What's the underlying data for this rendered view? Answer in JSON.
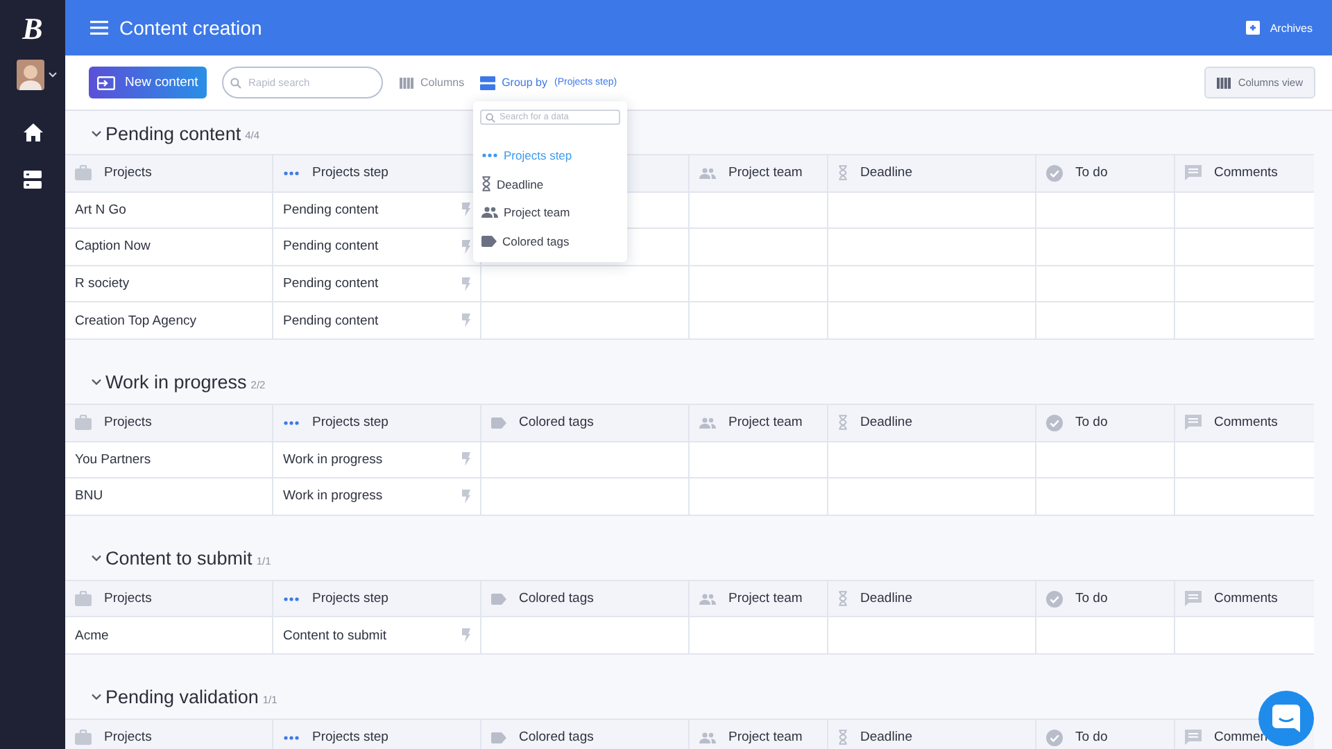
{
  "sidebar": {
    "logo": "B"
  },
  "header": {
    "title": "Content creation",
    "archives": "Archives"
  },
  "toolbar": {
    "new_button": "New content",
    "search": {
      "placeholder": "Rapid search"
    },
    "columns_button": "Columns",
    "group_by": {
      "label": "Group by",
      "value": "(Projects step)"
    },
    "view_button": "Columns view"
  },
  "group_menu": {
    "search": {
      "placeholder": "Search for a data"
    },
    "items": [
      {
        "label": "Projects step",
        "selected": true
      },
      {
        "label": "Deadline",
        "selected": false
      },
      {
        "label": "Project team",
        "selected": false
      },
      {
        "label": "Colored tags",
        "selected": false
      }
    ]
  },
  "sections": [
    {
      "title": "Pending content",
      "count": "4/4",
      "expanded": true,
      "columns": [
        {
          "label": "Projects"
        },
        {
          "label": "Projects step"
        },
        {},
        {
          "label": "Project team"
        },
        {
          "label": "Deadline"
        },
        {
          "label": "To do"
        },
        {
          "label": "Comments"
        }
      ],
      "rows": [
        {
          "project": "Art N Go",
          "step": "Pending content"
        },
        {
          "project": "Caption Now",
          "step": "Pending content"
        },
        {
          "project": "R society",
          "step": "Pending content"
        },
        {
          "project": "Creation Top Agency",
          "step": "Pending content"
        }
      ]
    },
    {
      "title": "Work in progress",
      "count": "2/2",
      "expanded": true,
      "columns": [
        {
          "label": "Projects"
        },
        {
          "label": "Projects step"
        },
        {
          "label": "Colored tags"
        },
        {
          "label": "Project team"
        },
        {
          "label": "Deadline"
        },
        {
          "label": "To do"
        },
        {
          "label": "Comments"
        }
      ],
      "rows": [
        {
          "project": "You Partners",
          "step": "Work in progress"
        },
        {
          "project": "BNU",
          "step": "Work in progress"
        }
      ]
    },
    {
      "title": "Content to submit",
      "count": "1/1",
      "expanded": true,
      "columns": [
        {
          "label": "Projects"
        },
        {
          "label": "Projects step"
        },
        {
          "label": "Colored tags"
        },
        {
          "label": "Project team"
        },
        {
          "label": "Deadline"
        },
        {
          "label": "To do"
        },
        {
          "label": "Comments"
        }
      ],
      "rows": [
        {
          "project": "Acme",
          "step": "Content to submit"
        }
      ]
    },
    {
      "title": "Pending validation",
      "count": "1/1",
      "expanded": true,
      "columns": [
        {
          "label": "Projects"
        },
        {
          "label": "Projects step"
        },
        {
          "label": "Colored tags"
        },
        {
          "label": "Project team"
        },
        {
          "label": "Deadline"
        },
        {
          "label": "To do"
        },
        {
          "label": "Commen"
        }
      ]
    }
  ]
}
